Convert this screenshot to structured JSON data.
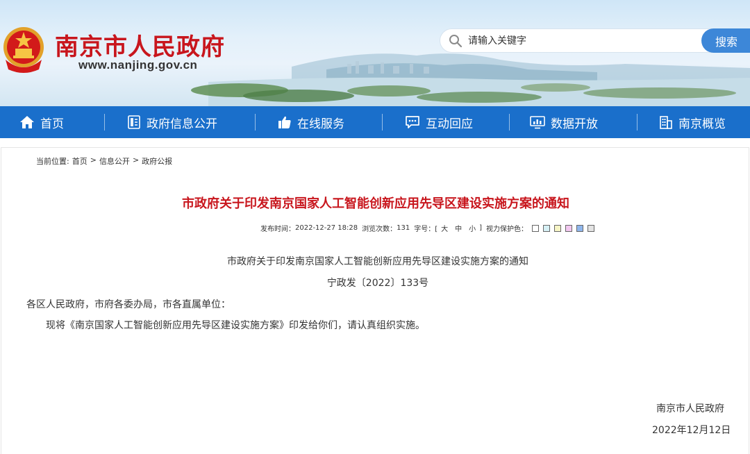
{
  "header": {
    "site_title": "南京市人民政府",
    "site_url": "www.nanjing.gov.cn",
    "search_placeholder": "请输入关键字",
    "search_button": "搜索"
  },
  "nav": {
    "items": [
      {
        "label": "首页",
        "icon": "home-icon"
      },
      {
        "label": "政府信息公开",
        "icon": "document-icon"
      },
      {
        "label": "在线服务",
        "icon": "thumbs-up-icon"
      },
      {
        "label": "互动回应",
        "icon": "chat-icon"
      },
      {
        "label": "数据开放",
        "icon": "monitor-chart-icon"
      },
      {
        "label": "南京概览",
        "icon": "building-icon"
      }
    ]
  },
  "breadcrumb": {
    "prefix": "当前位置:",
    "items": [
      "首页",
      "信息公开",
      "政府公报"
    ],
    "separator": ">"
  },
  "article": {
    "title": "市政府关于印发南京国家人工智能创新应用先导区建设实施方案的通知",
    "meta": {
      "publish_label": "发布时间：",
      "publish_time": "2022-12-27 18:28",
      "views_label": "浏览次数：",
      "views": "131",
      "font_label": "字号：[",
      "font_large": "大",
      "font_medium": "中",
      "font_small": "小",
      "font_close": "]",
      "vision_label": "视力保护色：",
      "swatches": [
        "#ffffff",
        "#d6f0f5",
        "#f7f5c6",
        "#f3c8f0",
        "#8fb6ec",
        "#e3e3e3"
      ]
    },
    "doc_heading": "市政府关于印发南京国家人工智能创新应用先导区建设实施方案的通知",
    "doc_number": "宁政发〔2022〕133号",
    "salutation": "各区人民政府，市府各委办局，市各直属单位：",
    "body": "现将《南京国家人工智能创新应用先导区建设实施方案》印发给你们，请认真组织实施。",
    "signer": "南京市人民政府",
    "sign_date": "2022年12月12日"
  },
  "colors": {
    "brand_red": "#c8161d",
    "nav_blue": "#1a6fcb",
    "search_blue": "#3d87d8"
  }
}
